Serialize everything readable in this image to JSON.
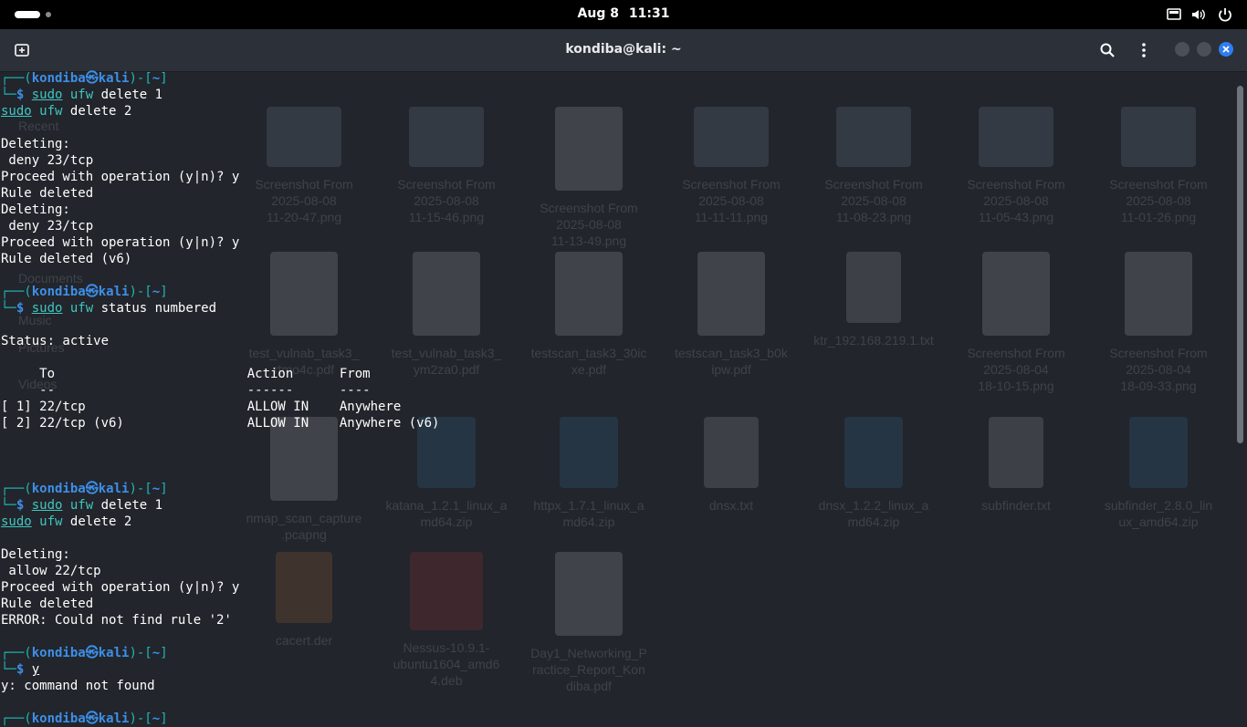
{
  "topbar": {
    "date": "Aug 8",
    "time": "11:31",
    "icons": [
      "activities-pill",
      "workspace-dot",
      "screen-icon",
      "volume-icon",
      "power-icon"
    ]
  },
  "header": {
    "title": "kondiba@kali: ~",
    "new_tab_icon": "new-tab-icon",
    "search_icon": "search-icon",
    "menu_icon": "kebab-menu-icon",
    "window_controls": [
      "minimize",
      "maximize",
      "close"
    ],
    "accent": "#2f7ef1"
  },
  "colors": {
    "background": "#22252b",
    "prompt_user": "#3d8fe8",
    "prompt_frame": "#1fb6b6",
    "command": "#40c6c0",
    "text": "#ffffff"
  },
  "wallpaper_files": [
    {
      "name": "Screenshot From\n2025-08-08\n11-20-47.png"
    },
    {
      "name": "Screenshot From\n2025-08-08\n11-15-46.png"
    },
    {
      "name": "Screenshot From\n2025-08-08\n11-13-49.png"
    },
    {
      "name": "Screenshot From\n2025-08-08\n11-11-11.png"
    },
    {
      "name": "Screenshot From\n2025-08-08\n11-08-23.png"
    },
    {
      "name": "Screenshot From\n2025-08-08\n11-05-43.png"
    },
    {
      "name": "Screenshot From\n2025-08-08\n11-01-26.png"
    },
    {
      "name": "test_vulnab_task3_\nrtmo4c.pdf"
    },
    {
      "name": "test_vulnab_task3_\nym2za0.pdf"
    },
    {
      "name": "testscan_task3_30ic\nxe.pdf"
    },
    {
      "name": "testscan_task3_b0k\nipw.pdf"
    },
    {
      "name": "ktr_192.168.219.1.txt"
    },
    {
      "name": "Screenshot From\n2025-08-04\n18-10-15.png"
    },
    {
      "name": "Screenshot From\n2025-08-04\n18-09-33.png"
    },
    {
      "name": "nmap_scan_capture\n.pcapng"
    },
    {
      "name": "katana_1.2.1_linux_a\nmd64.zip"
    },
    {
      "name": "httpx_1.7.1_linux_a\nmd64.zip"
    },
    {
      "name": "dnsx.txt"
    },
    {
      "name": "dnsx_1.2.2_linux_a\nmd64.zip"
    },
    {
      "name": "subfinder.txt"
    },
    {
      "name": "subfinder_2.8.0_lin\nux_amd64.zip"
    },
    {
      "name": "cacert.der"
    },
    {
      "name": "Nessus-10.9.1-\nubuntu1604_amd6\n4.deb"
    },
    {
      "name": "Day1_Networking_P\nractice_Report_Kon\ndiba.pdf"
    }
  ],
  "wallpaper_sidebar": [
    "Recent",
    "Documents",
    "Music",
    "Pictures",
    "Videos"
  ],
  "terminal": {
    "prompt_user": "kondiba",
    "prompt_host": "kali",
    "prompt_dir": "~",
    "blocks": [
      {
        "cmd": [
          "delete 1"
        ],
        "cont": "delete 2",
        "output": [
          "",
          "Deleting:",
          " deny 23/tcp",
          "Proceed with operation (y|n)? y",
          "Rule deleted",
          "Deleting:",
          " deny 23/tcp",
          "Proceed with operation (y|n)? y",
          "Rule deleted (v6)",
          ""
        ]
      },
      {
        "cmd": [
          "status numbered"
        ],
        "output": [
          "",
          "Status: active",
          "",
          "     To                         Action      From",
          "     --                         ------      ----",
          "[ 1] 22/tcp                     ALLOW IN    Anywhere",
          "[ 2] 22/tcp (v6)                ALLOW IN    Anywhere (v6)",
          "",
          "",
          ""
        ]
      },
      {
        "cmd": [
          "delete 1"
        ],
        "cont": "delete 2",
        "output": [
          "",
          "Deleting:",
          " allow 22/tcp",
          "Proceed with operation (y|n)? y",
          "Rule deleted",
          "ERROR: Could not find rule '2'",
          ""
        ]
      },
      {
        "typed": "y",
        "output": [
          "y: command not found",
          ""
        ]
      }
    ]
  }
}
